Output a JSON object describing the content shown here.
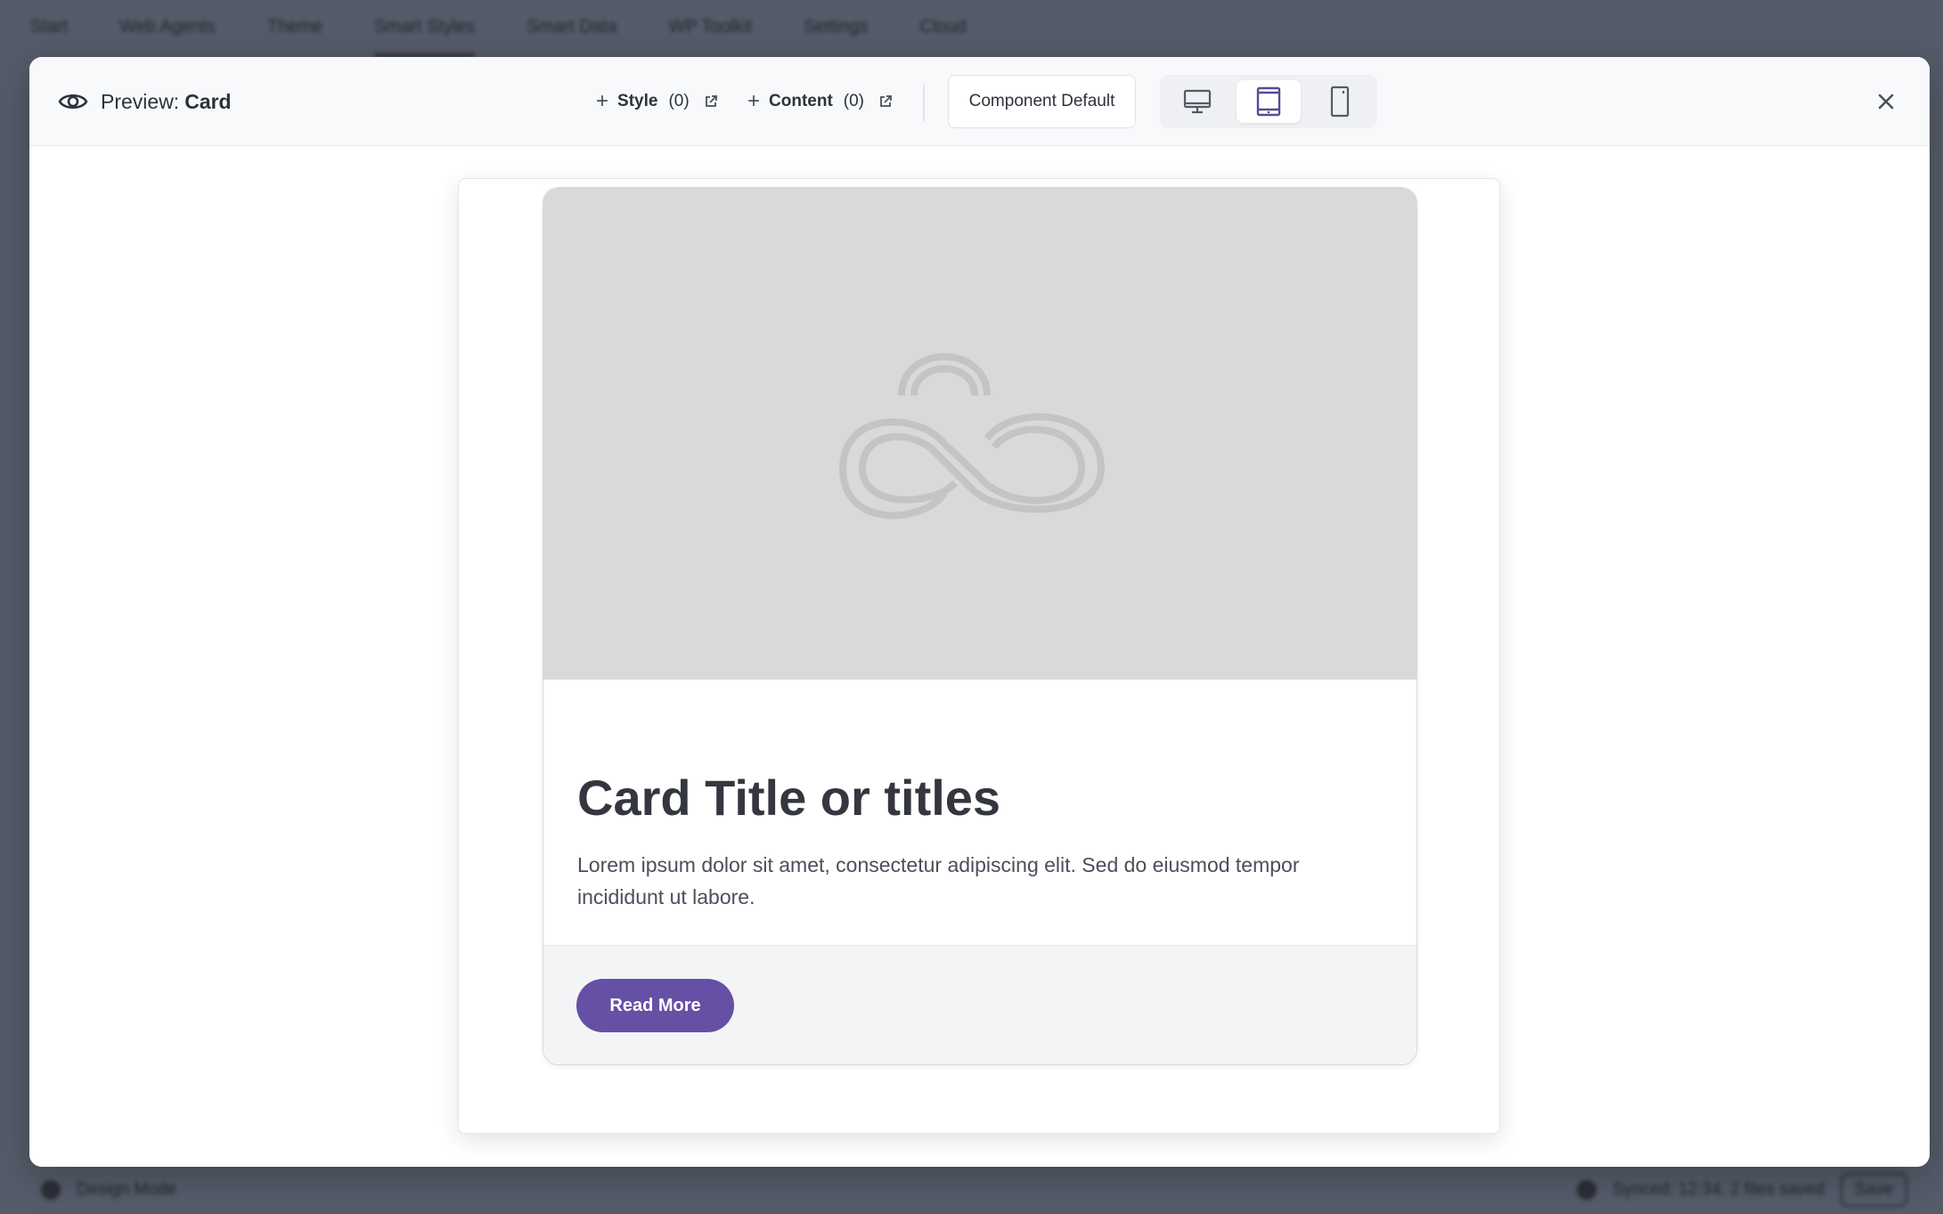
{
  "background": {
    "nav": [
      "Start",
      "Web Agents",
      "Theme",
      "Smart Styles",
      "Smart Data",
      "WP Toolkit",
      "Settings",
      "Cloud"
    ],
    "footer": {
      "left": "Design Mode",
      "right_status": "Synced: 12:34, 2 files saved",
      "right_button": "Save"
    }
  },
  "modal": {
    "title_prefix": "Preview:",
    "title_name": "Card",
    "style_button": {
      "plus": "+",
      "label": "Style",
      "count": "(0)"
    },
    "content_button": {
      "plus": "+",
      "label": "Content",
      "count": "(0)"
    },
    "variant_select": "Component Default",
    "devices": [
      {
        "name": "desktop",
        "active": false
      },
      {
        "name": "tablet",
        "active": true
      },
      {
        "name": "mobile",
        "active": false
      }
    ],
    "close_symbol": "×"
  },
  "card": {
    "title": "Card Title or titles",
    "text": "Lorem ipsum dolor sit amet, consectetur adipiscing elit. Sed do eiusmod tempor incididunt ut labore.",
    "button_label": "Read More"
  },
  "colors": {
    "accent": "#6650a5",
    "overlay": "#555b69",
    "image_placeholder": "#d9d9d9"
  },
  "icons": {
    "title": "eye-icon",
    "external": "external-link-icon",
    "placeholder": "cloud-logo-icon",
    "close": "close-icon"
  }
}
